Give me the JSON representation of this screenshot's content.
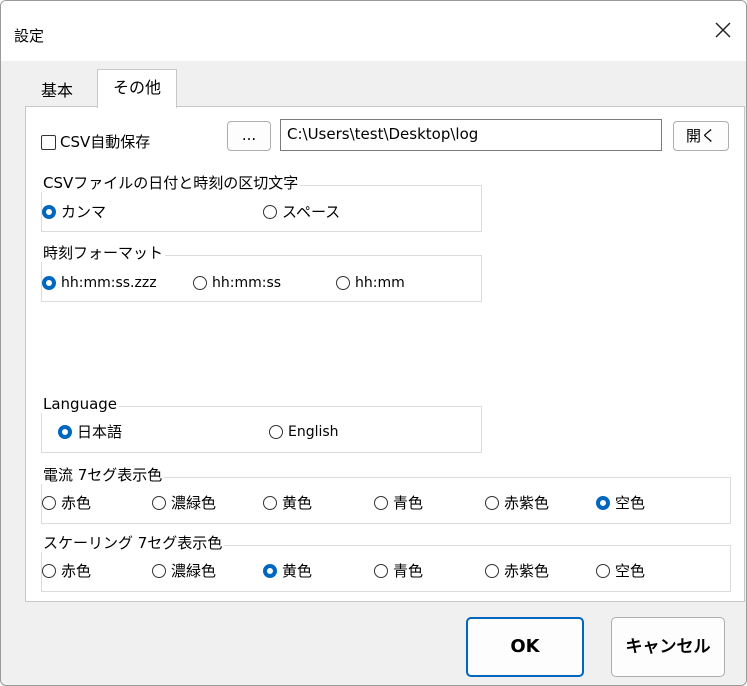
{
  "window": {
    "title": "設定"
  },
  "tabs": [
    {
      "label": "基本",
      "selected": false
    },
    {
      "label": "その他",
      "selected": true
    }
  ],
  "csv": {
    "autosave_label": "CSV自動保存",
    "autosave_checked": false,
    "browse_label": "...",
    "path_value": "C:\\Users\\test\\Desktop\\log",
    "open_label": "開く"
  },
  "separator_group": {
    "title": "CSVファイルの日付と時刻の区切文字",
    "options": [
      "カンマ",
      "スペース"
    ],
    "selected": "カンマ"
  },
  "time_format_group": {
    "title": "時刻フォーマット",
    "options": [
      "hh:mm:ss.zzz",
      "hh:mm:ss",
      "hh:mm"
    ],
    "selected": "hh:mm:ss.zzz"
  },
  "language_group": {
    "title": "Language",
    "options": [
      "日本語",
      "English"
    ],
    "selected": "日本語"
  },
  "current_color_group": {
    "title": "電流 7セグ表示色",
    "options": [
      "赤色",
      "濃緑色",
      "黄色",
      "青色",
      "赤紫色",
      "空色"
    ],
    "selected": "空色"
  },
  "scaling_color_group": {
    "title": "スケーリング 7セグ表示色",
    "options": [
      "赤色",
      "濃緑色",
      "黄色",
      "青色",
      "赤紫色",
      "空色"
    ],
    "selected": "黄色"
  },
  "buttons": {
    "ok_label": "OK",
    "cancel_label": "キャンセル"
  },
  "colors": {
    "accent": "#0067c0",
    "panel_bg": "#ffffff",
    "window_bg": "#f0f0f0"
  }
}
